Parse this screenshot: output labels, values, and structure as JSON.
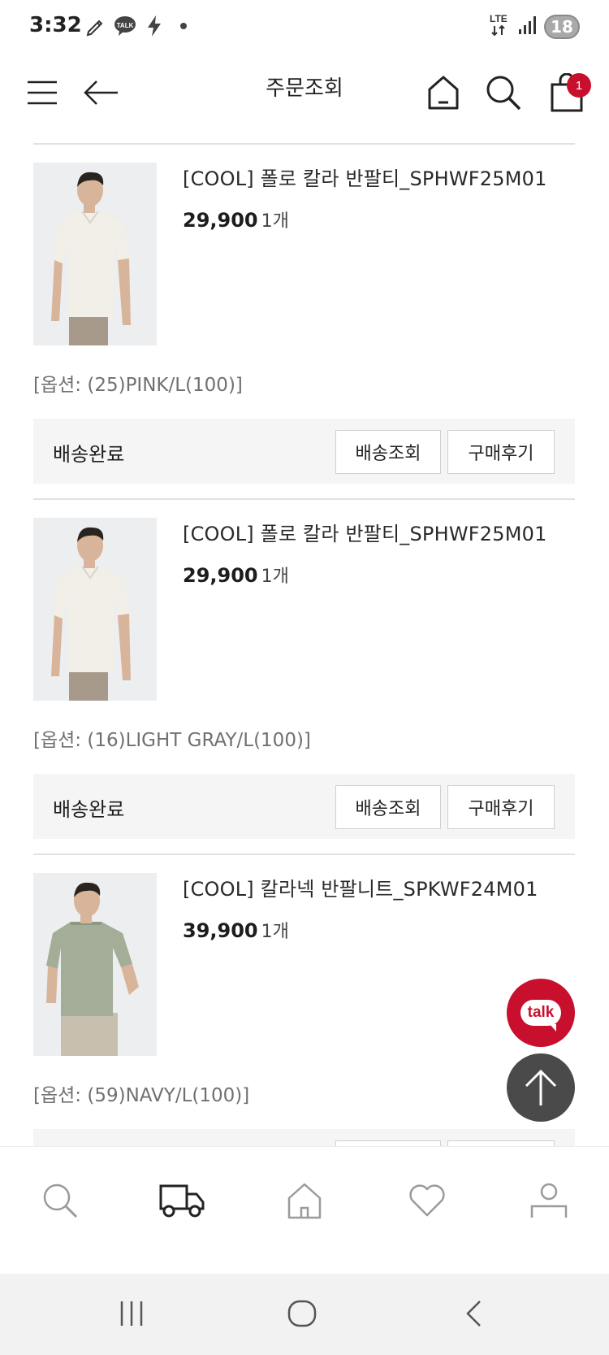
{
  "status_bar": {
    "time": "3:32",
    "talk_label": "TALK",
    "network": "LTE",
    "battery": "18",
    "icons": [
      "pen-icon",
      "talk-icon",
      "flash-icon",
      "dot-icon",
      "lte-icon",
      "signal-icon",
      "battery-icon"
    ]
  },
  "header": {
    "title": "주문조회",
    "cart_count": "1",
    "icons": [
      "menu-icon",
      "back-arrow-icon",
      "home-icon",
      "search-icon",
      "cart-icon"
    ]
  },
  "orders": [
    {
      "name": "[COOL] 폴로 칼라 반팔티_SPHWF25M01",
      "price": "29,900",
      "qty": "1개",
      "option": "[옵션: (25)PINK/L(100)]",
      "status": "배송완료",
      "track_label": "배송조회",
      "review_label": "구매후기",
      "shirt_color": "#f1efe8",
      "pants_color": "#a89a8a"
    },
    {
      "name": "[COOL] 폴로 칼라 반팔티_SPHWF25M01",
      "price": "29,900",
      "qty": "1개",
      "option": "[옵션: (16)LIGHT GRAY/L(100)]",
      "status": "배송완료",
      "track_label": "배송조회",
      "review_label": "구매후기",
      "shirt_color": "#f1efe8",
      "pants_color": "#a89a8a"
    },
    {
      "name": "[COOL] 칼라넥 반팔니트_SPKWF24M01",
      "price": "39,900",
      "qty": "1개",
      "option": "[옵션: (59)NAVY/L(100)]",
      "status": "",
      "track_label": "",
      "review_label": "",
      "shirt_color": "#a3ad97",
      "pants_color": "#c8bfae"
    }
  ],
  "floating": {
    "talk_label": "talk",
    "top_icon": "arrow-up-icon"
  },
  "bottom_nav": [
    "search-icon",
    "delivery-truck-icon",
    "home-icon",
    "heart-icon",
    "user-icon"
  ],
  "system_nav": [
    "recent-apps-icon",
    "home-circle-icon",
    "back-chevron-icon"
  ],
  "colors": {
    "accent_red": "#c8102e",
    "divider": "#e2e2e2",
    "status_bg": "#f5f5f5",
    "option_text": "#707070",
    "fab_dark": "#4a4a4a"
  }
}
